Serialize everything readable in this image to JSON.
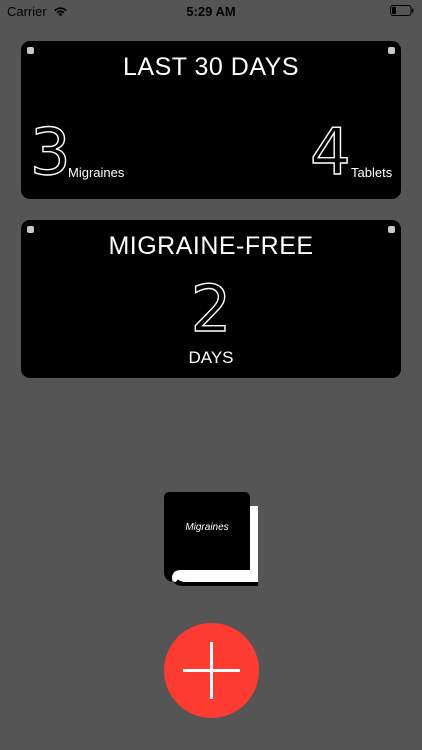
{
  "status_bar": {
    "carrier": "Carrier",
    "time": "5:29 AM",
    "wifi_icon": "wifi-icon",
    "battery_icon": "battery-icon"
  },
  "last30": {
    "title": "LAST 30 DAYS",
    "migraines_count": "3",
    "migraines_label": "Migraines",
    "tablets_count": "4",
    "tablets_label": "Tablets"
  },
  "migraine_free": {
    "title": "MIGRAINE-FREE",
    "count": "2",
    "unit": "DAYS"
  },
  "book": {
    "label": "Migraines",
    "icon": "book-icon"
  },
  "add": {
    "icon": "plus-icon"
  },
  "colors": {
    "background": "#555555",
    "card": "#000000",
    "accent": "#fe3b30",
    "text": "#ffffff"
  }
}
